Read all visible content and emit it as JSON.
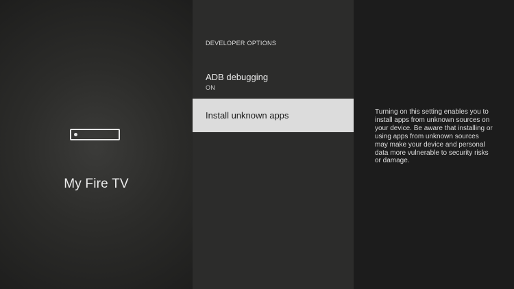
{
  "device": {
    "icon": "fire-tv-stick-icon",
    "name": "My Fire TV"
  },
  "developer_options": {
    "header": "DEVELOPER OPTIONS",
    "items": [
      {
        "title": "ADB debugging",
        "subtitle": "ON",
        "selected": false
      },
      {
        "title": "Install unknown apps",
        "subtitle": "",
        "selected": true
      }
    ]
  },
  "description": "Turning on this setting enables you to install apps from unknown sources on your device. Be aware that installing or using apps from unknown sources may make your device and personal data more vulnerable to security risks or damage.",
  "colors": {
    "selected_background": "#dcdcdc",
    "selected_text": "#1b1b1b"
  }
}
